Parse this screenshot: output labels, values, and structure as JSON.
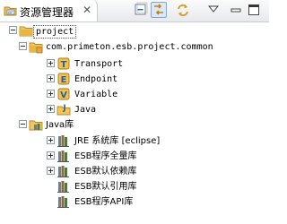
{
  "view": {
    "title": "资源管理器",
    "close_glyph": "✕",
    "toolbar": [
      {
        "name": "collapse-all-icon"
      },
      {
        "name": "link-with-editor-icon",
        "active": true
      },
      {
        "name": "sync-icon"
      },
      {
        "name": "view-menu-icon"
      },
      {
        "name": "minimize-icon"
      },
      {
        "name": "maximize-icon"
      }
    ]
  },
  "tree": {
    "project": {
      "label": "project",
      "icon": "project-folder-icon",
      "expanded": true
    },
    "package": {
      "label": "com.primeton.esb.project.common",
      "icon": "package-folder-icon",
      "expanded": true
    },
    "items": [
      {
        "label": "Transport",
        "icon": "transport-icon"
      },
      {
        "label": "Endpoint",
        "icon": "endpoint-icon"
      },
      {
        "label": "Variable",
        "icon": "variable-icon"
      },
      {
        "label": "Java",
        "icon": "java-folder-icon"
      }
    ],
    "java_lib": {
      "label": "Java库",
      "icon": "library-icon",
      "expanded": true
    },
    "libraries": [
      {
        "label": "JRE 系统库 [eclipse]",
        "expandable": true
      },
      {
        "label": "ESB程序全量库",
        "expandable": true
      },
      {
        "label": "ESB默认依赖库",
        "expandable": true
      },
      {
        "label": "ESB默认引用库",
        "expandable": false
      },
      {
        "label": "ESB程序API库",
        "expandable": false
      }
    ]
  },
  "colors": {
    "selection_outline": "#555555",
    "folder": "#e8b443",
    "library_book": "#6e7f95",
    "toggle_border": "#8d9aa8"
  }
}
